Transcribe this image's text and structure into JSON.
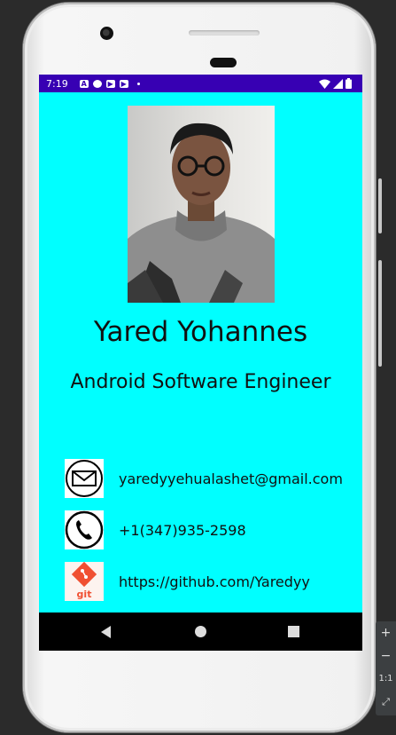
{
  "status_bar": {
    "time": "7:19",
    "left_icons": [
      "a-icon",
      "assistant-icon",
      "youtube-icon",
      "youtube-icon",
      "dot"
    ],
    "right_icons": [
      "wifi-icon",
      "signal-icon",
      "battery-icon"
    ],
    "color": "#3700b3"
  },
  "profile": {
    "name": "Yared Yohannes",
    "title": "Android Software Engineer",
    "background": "#00ffff"
  },
  "contacts": [
    {
      "icon": "email-icon",
      "text": "yaredyyehualashet@gmail.com"
    },
    {
      "icon": "phone-icon",
      "text": "+1(347)935-2598"
    },
    {
      "icon": "git-icon",
      "text": "https://github.com/Yaredyy",
      "icon_label": "git"
    }
  ],
  "nav_bar": [
    "back-button",
    "home-button",
    "recents-button"
  ],
  "emulator_controls": [
    "+",
    "−",
    "1:1",
    "⤢"
  ]
}
